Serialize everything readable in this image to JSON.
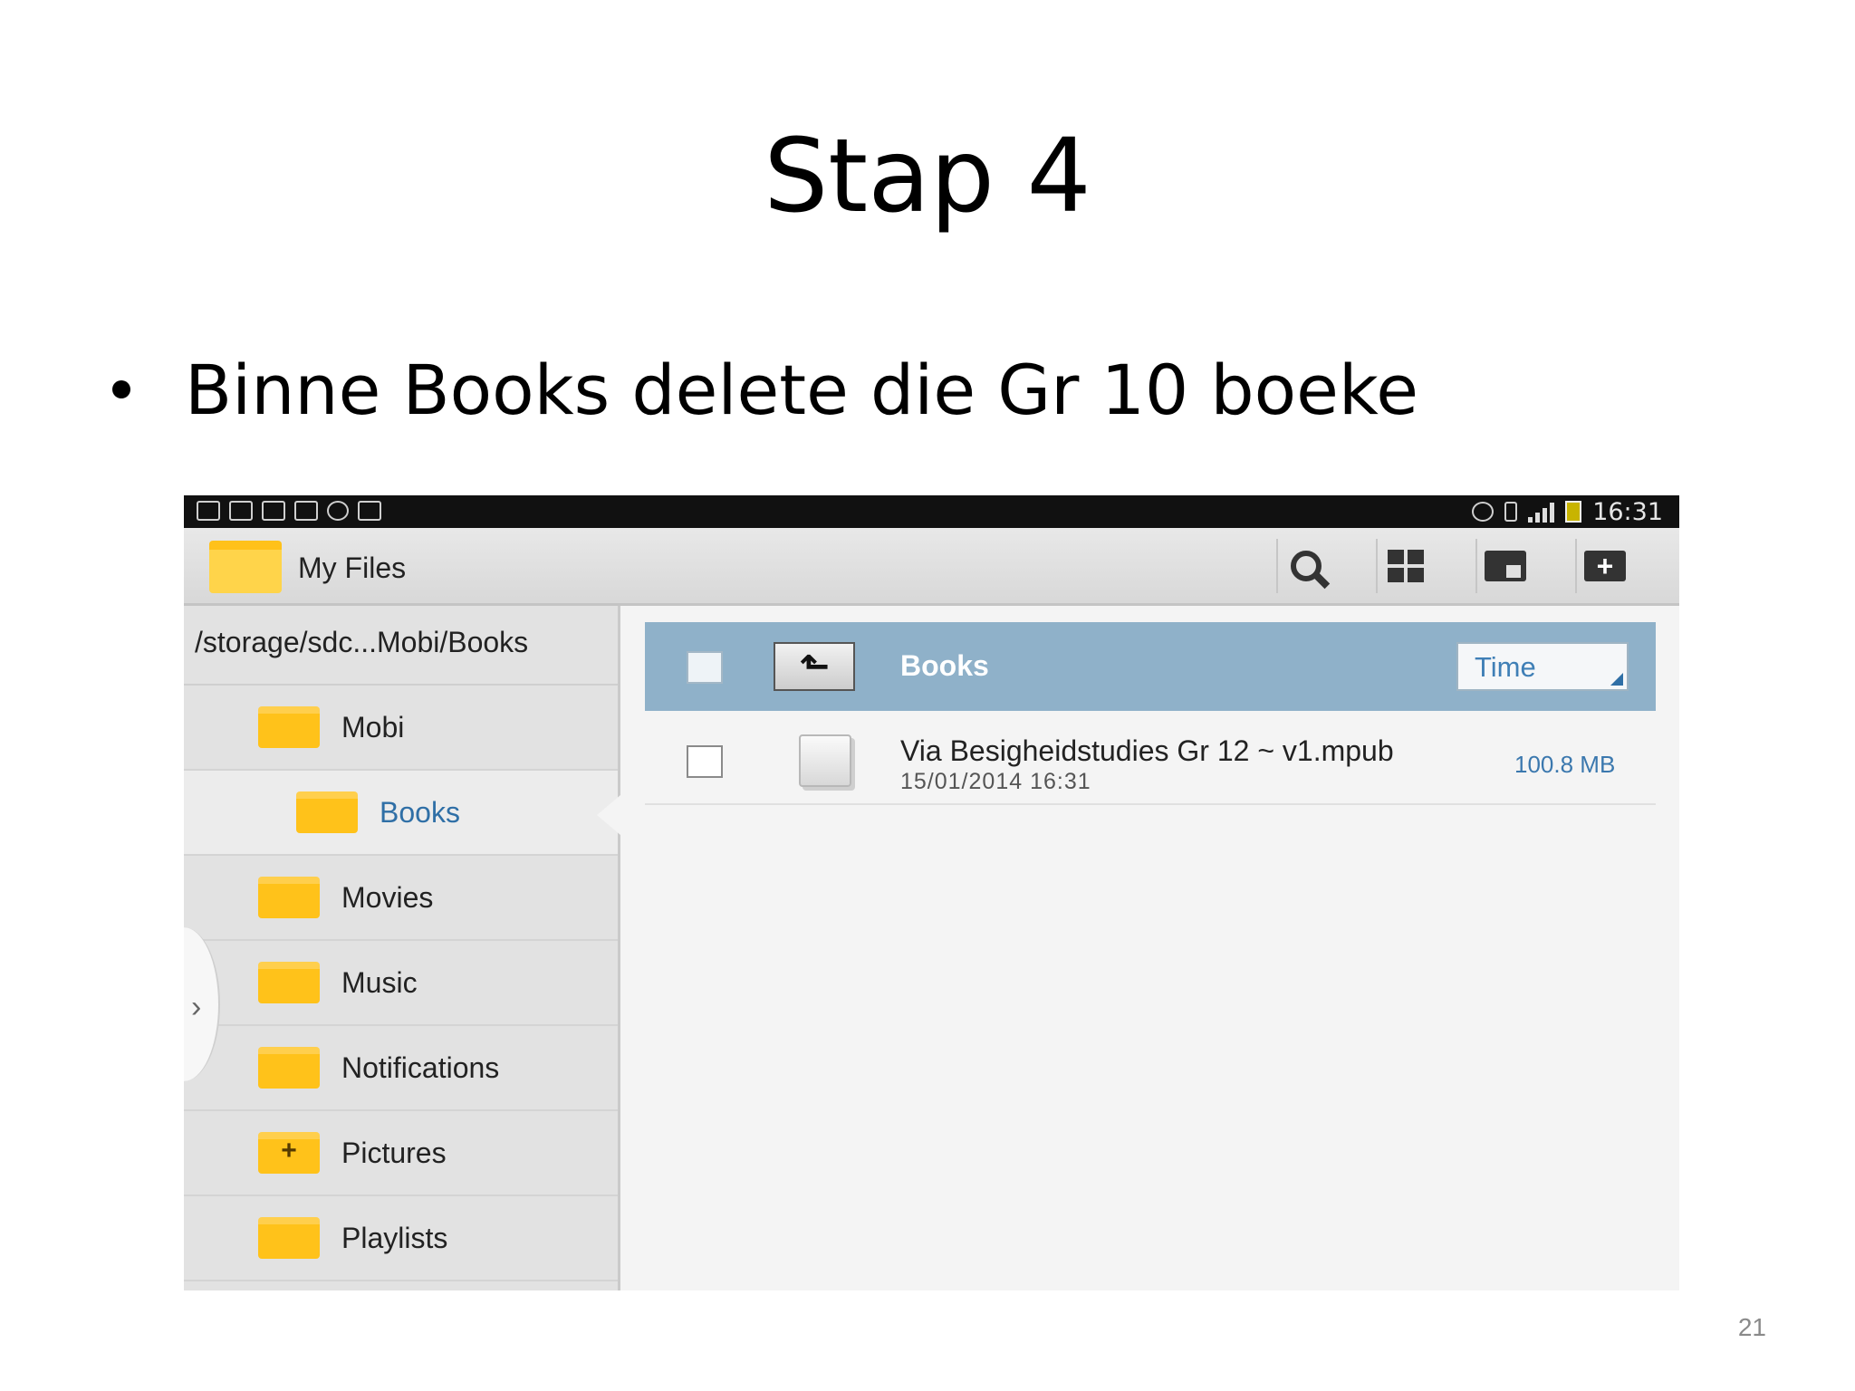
{
  "slide": {
    "title": "Stap 4",
    "bullet": "Binne Books delete die Gr 10 boeke",
    "number": "21"
  },
  "status_bar": {
    "time": "16:31",
    "left_icons": [
      "usb-icon",
      "screen-mirror-icon",
      "gallery-icon",
      "download-icon",
      "cloud-alert-icon",
      "briefcase-icon"
    ],
    "right_icons": [
      "eye-icon",
      "data-hplus-icon",
      "signal-icon",
      "battery-icon"
    ]
  },
  "app_bar": {
    "title": "My Files",
    "actions": [
      "search-icon",
      "view-grid-icon",
      "home-folder-icon",
      "new-folder-icon"
    ]
  },
  "sidebar": {
    "path": "/storage/sdc...Mobi/Books",
    "items": [
      {
        "label": "Mobi",
        "icon": "folder-icon",
        "level": 1
      },
      {
        "label": "Books",
        "icon": "folder-icon",
        "level": 2,
        "selected": true
      },
      {
        "label": "Movies",
        "icon": "folder-icon",
        "level": 1
      },
      {
        "label": "Music",
        "icon": "folder-icon",
        "level": 1
      },
      {
        "label": "Notifications",
        "icon": "folder-icon",
        "level": 1
      },
      {
        "label": "Pictures",
        "icon": "folder-plus-icon",
        "level": 1
      },
      {
        "label": "Playlists",
        "icon": "folder-icon",
        "level": 1
      }
    ]
  },
  "file_list": {
    "header_title": "Books",
    "sort_label": "Time",
    "files": [
      {
        "name": "Via Besigheidstudies Gr 12 ~ v1.mpub",
        "date": "15/01/2014 16:31",
        "size": "100.8 MB"
      }
    ]
  },
  "colors": {
    "header_blue": "#8fb1c9",
    "selected_text": "#2f6fa6",
    "folder_yellow": "#ffc21a"
  }
}
